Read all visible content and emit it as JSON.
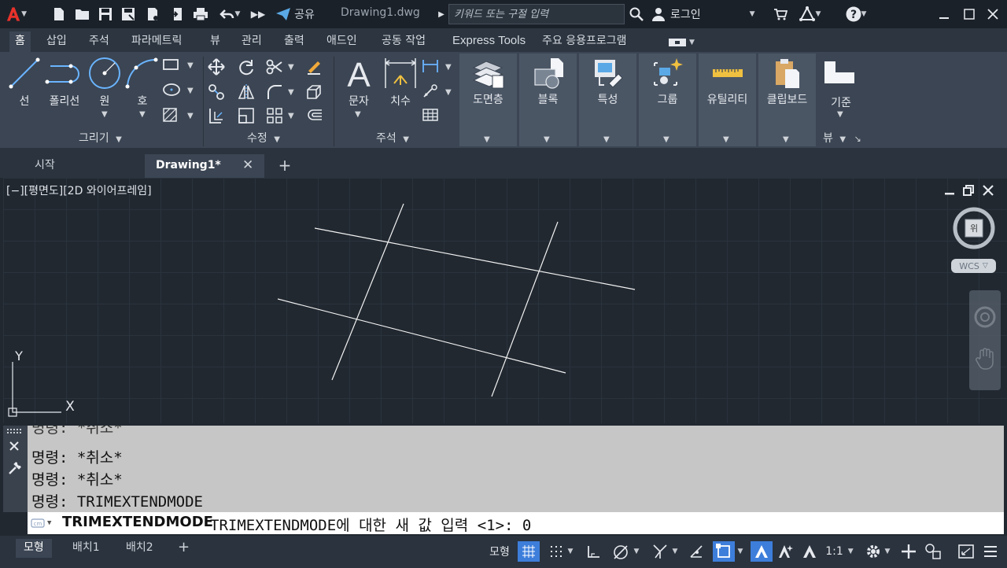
{
  "titlebar": {
    "document_name": "Drawing1.dwg",
    "share_label": "공유",
    "search_placeholder": "키워드 또는 구절 입력",
    "login_label": "로그인"
  },
  "ribbon_tabs": [
    {
      "label": "홈"
    },
    {
      "label": "삽입"
    },
    {
      "label": "주석"
    },
    {
      "label": "파라메트릭"
    },
    {
      "label": "뷰"
    },
    {
      "label": "관리"
    },
    {
      "label": "출력"
    },
    {
      "label": "애드인"
    },
    {
      "label": "공동 작업"
    },
    {
      "label": "Express Tools"
    },
    {
      "label": "주요 응용프로그램"
    }
  ],
  "ribbon": {
    "draw": {
      "line": "선",
      "polyline": "폴리선",
      "circle": "원",
      "arc": "호",
      "panel": "그리기"
    },
    "modify": {
      "panel": "수정"
    },
    "annotation": {
      "text": "문자",
      "dimension": "치수",
      "panel": "주석"
    },
    "layers": "도면층",
    "block": "블록",
    "properties": "특성",
    "groups": "그룹",
    "utilities": "유틸리티",
    "clipboard": "클립보드",
    "view": {
      "base": "기준",
      "panel": "뷰"
    }
  },
  "file_tabs": [
    {
      "label": "시작"
    },
    {
      "label": "Drawing1*"
    }
  ],
  "viewport": {
    "label": "[−][평면도][2D 와이어프레임]",
    "viewcube_label": "위",
    "wcs_label": "WCS",
    "ucs_x": "X",
    "ucs_y": "Y"
  },
  "command_history": [
    "명령: *취소*",
    "명령: *취소*",
    "명령: TRIMEXTENDMODE"
  ],
  "command_line": {
    "command": "TRIMEXTENDMODE",
    "prompt": "TRIMEXTENDMODE에 대한 새 값 입력 <1>: 0"
  },
  "layout_tabs": [
    {
      "label": "모형"
    },
    {
      "label": "배치1"
    },
    {
      "label": "배치2"
    }
  ],
  "status": {
    "model_label": "모형",
    "scale_label": "1:1"
  },
  "colors": {
    "accent": "#3d7edb",
    "autocad_red": "#e8322b",
    "canvas": "#212830"
  }
}
